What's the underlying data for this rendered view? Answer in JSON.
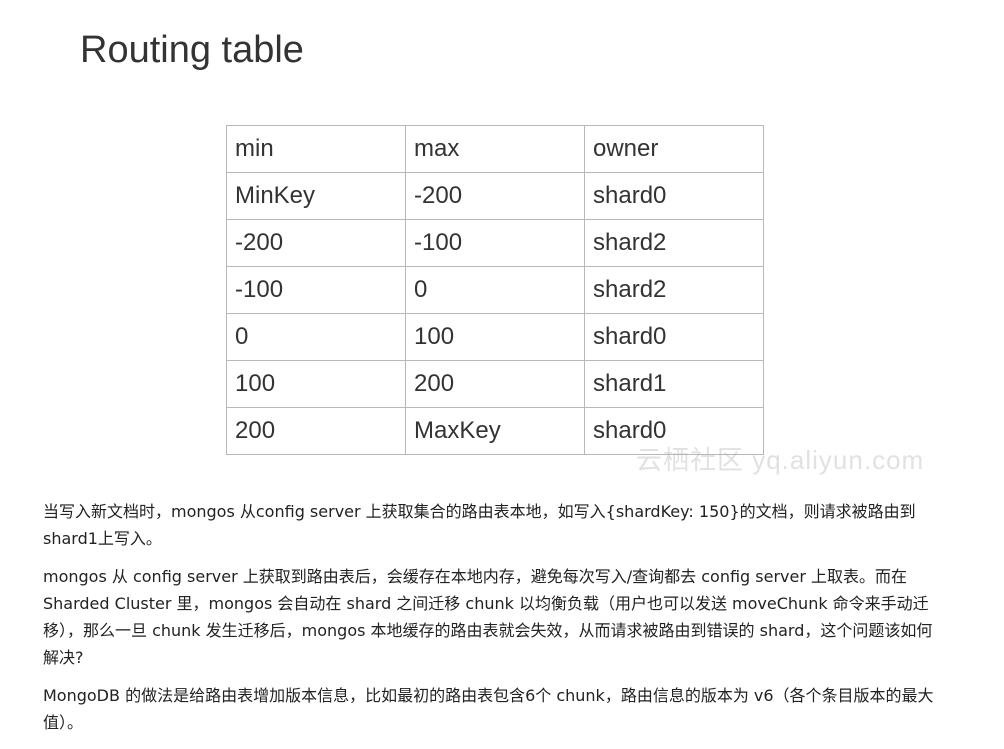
{
  "title": "Routing table",
  "table": {
    "header": [
      "min",
      "max",
      "owner"
    ],
    "rows": [
      [
        "MinKey",
        "-200",
        "shard0"
      ],
      [
        "-200",
        "-100",
        "shard2"
      ],
      [
        "-100",
        "0",
        "shard2"
      ],
      [
        "0",
        "100",
        "shard0"
      ],
      [
        "100",
        "200",
        "shard1"
      ],
      [
        "200",
        "MaxKey",
        "shard0"
      ]
    ]
  },
  "watermark": "云栖社区 yq.aliyun.com",
  "paragraphs": [
    "当写入新文档时，mongos 从config server 上获取集合的路由表本地，如写入{shardKey: 150}的文档，则请求被路由到shard1上写入。",
    "mongos 从 config server 上获取到路由表后，会缓存在本地内存，避免每次写入/查询都去 config server 上取表。而在 Sharded Cluster 里，mongos 会自动在 shard 之间迁移 chunk 以均衡负载（用户也可以发送 moveChunk 命令来手动迁移），那么一旦 chunk 发生迁移后，mongos 本地缓存的路由表就会失效，从而请求被路由到错误的 shard，这个问题该如何解决?",
    "MongoDB 的做法是给路由表增加版本信息，比如最初的路由表包含6个 chunk，路由信息的版本为 v6（各个条目版本的最大值）。"
  ]
}
